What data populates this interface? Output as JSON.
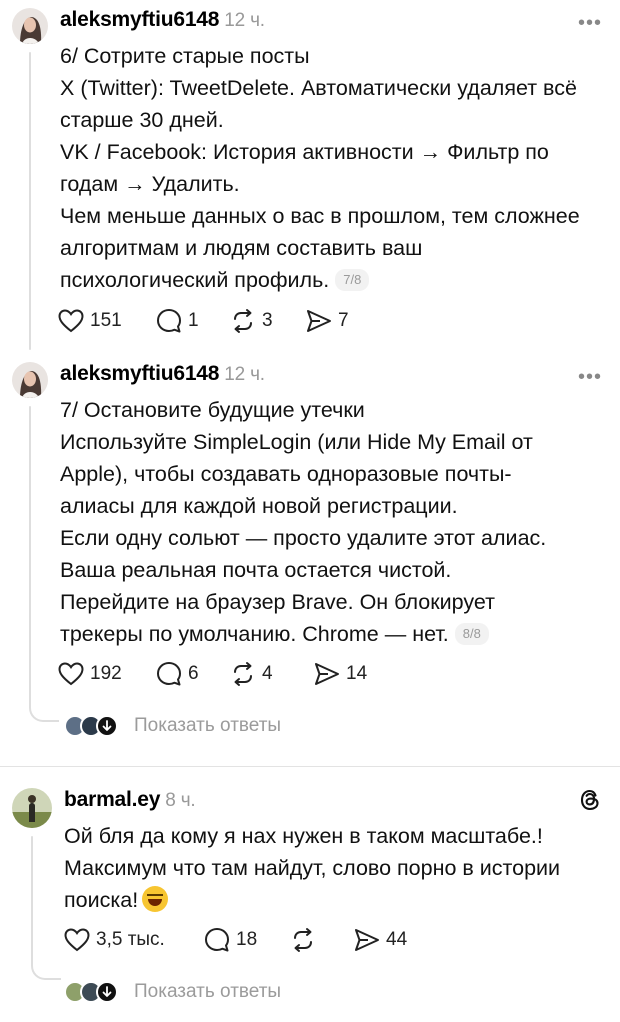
{
  "posts": [
    {
      "author": "aleksmyftiu6148",
      "time": "12 ч.",
      "lines": [
        "6/ Сотрите старые посты",
        "X (Twitter): TweetDelete. Автоматически удаляет всё",
        "старше 30 дней.",
        "VK / Facebook: История активности → Фильтр по",
        "годам → Удалить.",
        "Чем меньше данных о вас в прошлом, тем сложнее",
        "алгоритмам и людям составить ваш",
        "психологический профиль."
      ],
      "counter": "7/8",
      "likes": "151",
      "comments": "1",
      "reposts": "3",
      "shares": "7"
    },
    {
      "author": "aleksmyftiu6148",
      "time": "12 ч.",
      "lines": [
        "7/ Остановите будущие утечки",
        "Используйте SimpleLogin (или Hide My Email от",
        "Apple), чтобы создавать одноразовые почты-",
        "алиасы для каждой новой регистрации.",
        "Если одну сольют — просто удалите этот алиас.",
        "Ваша реальная почта остается чистой.",
        "Перейдите на браузер Brave. Он блокирует",
        "трекеры по умолчанию. Chrome — нет."
      ],
      "counter": "8/8",
      "likes": "192",
      "comments": "6",
      "reposts": "4",
      "shares": "14",
      "show_replies": "Показать ответы"
    },
    {
      "author": "barmal.ey",
      "time": "8 ч.",
      "lines": [
        "Ой бля да кому я нах нужен в таком масштабе.!",
        "Максимум что там найдут, слово порно в истории",
        "поиска!"
      ],
      "emoji": "grinning-squinting-face-emoji",
      "likes": "3,5 тыс.",
      "comments": "18",
      "reposts": "",
      "shares": "44",
      "show_replies": "Показать ответы"
    }
  ],
  "icons": {
    "more": "more-options-icon",
    "like": "heart-icon",
    "comment": "comment-icon",
    "repost": "repost-icon",
    "share": "share-icon",
    "threads": "threads-logo-icon"
  },
  "colors": {
    "text": "#111111",
    "muted": "#999999",
    "divider": "#e3e3e3",
    "thread_line": "#dedede"
  }
}
